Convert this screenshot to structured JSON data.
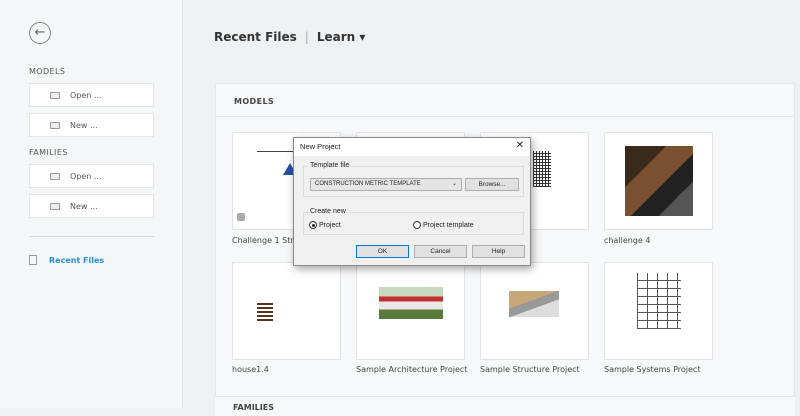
{
  "sidebar": {
    "models_title": "MODELS",
    "families_title": "FAMILIES",
    "open": "Open ...",
    "new": "New ...",
    "recent_files": "Recent Files"
  },
  "header": {
    "recent_files": "Recent Files",
    "separator": "|",
    "learn": "Learn ▾"
  },
  "panel": {
    "title": "MODELS",
    "families_title": "FAMILIES",
    "files": [
      {
        "name": "Challenge 1 Structure"
      },
      {
        "name": ""
      },
      {
        "name": ""
      },
      {
        "name": "challenge 4"
      },
      {
        "name": "house1.4"
      },
      {
        "name": "Sample Architecture Project"
      },
      {
        "name": "Sample Structure Project"
      },
      {
        "name": "Sample Systems Project"
      }
    ]
  },
  "dialog": {
    "title": "New Project",
    "close": "✕",
    "template_label": "Template file",
    "template_value": "CONSTRUCTION METRIC TEMPLATE",
    "browse": "Browse...",
    "create_new": "Create new",
    "project": "Project",
    "project_template": "Project template",
    "ok": "OK",
    "cancel": "Cancel",
    "help": "Help"
  }
}
